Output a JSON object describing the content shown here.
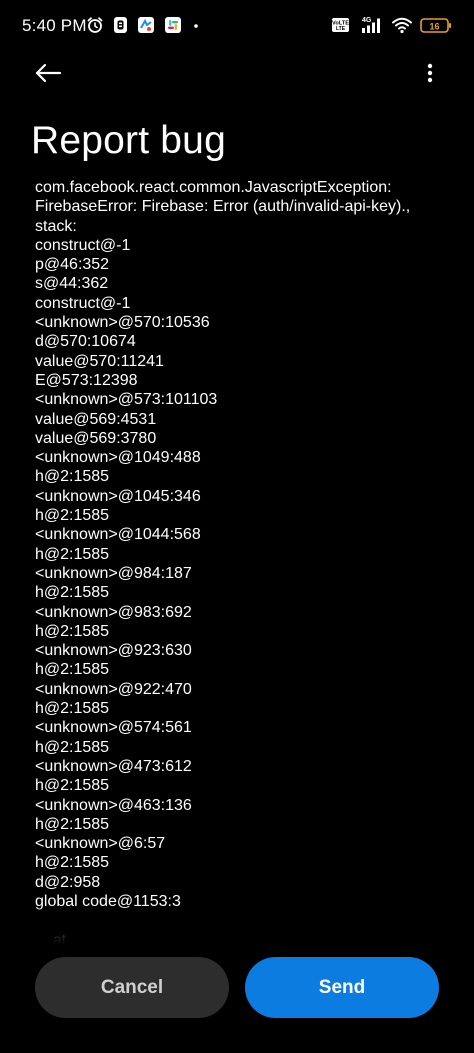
{
  "status_bar": {
    "time": "5:40 PM",
    "network_type": "4G",
    "volte_label": "VoLTE",
    "battery_level": "16",
    "icons_left": [
      "alarm-clock-icon",
      "notification-app-icon",
      "app-badge-icon",
      "slack-icon",
      "dot-icon"
    ],
    "icons_right": [
      "volte-icon",
      "signal-icon",
      "wifi-icon",
      "battery-icon"
    ]
  },
  "app_bar": {
    "back_icon": "arrow-left-icon",
    "more_icon": "more-vertical-icon"
  },
  "page": {
    "title": "Report bug"
  },
  "report": {
    "text": "com.facebook.react.common.JavascriptException: FirebaseError: Firebase: Error (auth/invalid-api-key)., stack:\nconstruct@-1\np@46:352\ns@44:362\nconstruct@-1\n<unknown>@570:10536\nd@570:10674\nvalue@570:11241\nE@573:12398\n<unknown>@573:101103\nvalue@569:4531\nvalue@569:3780\n<unknown>@1049:488\nh@2:1585\n<unknown>@1045:346\nh@2:1585\n<unknown>@1044:568\nh@2:1585\n<unknown>@984:187\nh@2:1585\n<unknown>@983:692\nh@2:1585\n<unknown>@923:630\nh@2:1585\n<unknown>@922:470\nh@2:1585\n<unknown>@574:561\nh@2:1585\n<unknown>@473:612\nh@2:1585\n<unknown>@463:136\nh@2:1585\n<unknown>@6:57\nh@2:1585\nd@2:958\nglobal code@1153:3\n\n    at"
  },
  "actions": {
    "cancel_label": "Cancel",
    "send_label": "Send"
  },
  "colors": {
    "background": "#000000",
    "primary_button": "#0d7ce0",
    "secondary_button": "#2d2d2d",
    "text": "#ffffff"
  }
}
